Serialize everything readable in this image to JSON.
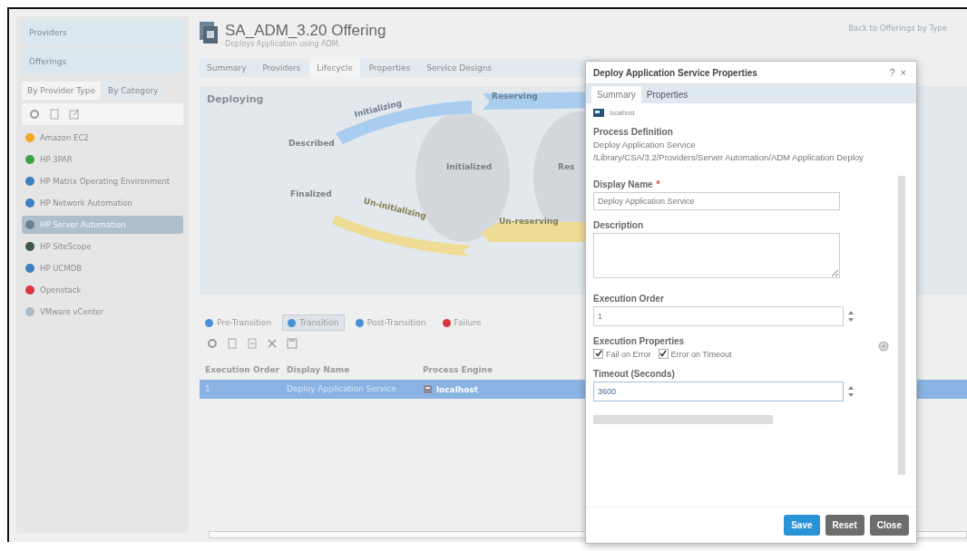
{
  "sidebar": {
    "sections": [
      {
        "label": "Providers"
      },
      {
        "label": "Offerings"
      }
    ],
    "tabs": [
      {
        "label": "By Provider Type",
        "selected": true
      },
      {
        "label": "By Category",
        "selected": false
      }
    ],
    "items": [
      {
        "label": "Amazon EC2",
        "color": "#f2a623",
        "selected": false
      },
      {
        "label": "HP 3PAR",
        "color": "#3aa34a",
        "selected": false
      },
      {
        "label": "HP Matrix Operating Environment",
        "color": "#3d7fc1",
        "selected": false
      },
      {
        "label": "HP Network Automation",
        "color": "#3d7fc1",
        "selected": false
      },
      {
        "label": "HP Server Automation",
        "color": "#6d7f92",
        "selected": true
      },
      {
        "label": "HP SiteScope",
        "color": "#3e5a44",
        "selected": false
      },
      {
        "label": "HP UCMDB",
        "color": "#3d7fc1",
        "selected": false
      },
      {
        "label": "Openstack",
        "color": "#d9363e",
        "selected": false
      },
      {
        "label": "VMware vCenter",
        "color": "#a9bccb",
        "selected": false
      }
    ]
  },
  "header": {
    "title": "SA_ADM_3.20 Offering",
    "subtitle": "Deploys Application using ADM.",
    "back_link": "Back to Offerings by Type"
  },
  "tabs": [
    {
      "label": "Summary",
      "selected": false
    },
    {
      "label": "Providers",
      "selected": false
    },
    {
      "label": "Lifecycle",
      "selected": true
    },
    {
      "label": "Properties",
      "selected": false
    },
    {
      "label": "Service Designs",
      "selected": false
    }
  ],
  "lifecycle": {
    "heading": "Deploying",
    "labels": [
      {
        "text": "Initializing",
        "kind": "forward"
      },
      {
        "text": "Reserving",
        "kind": "forward"
      },
      {
        "text": "Described",
        "kind": "state"
      },
      {
        "text": "Initialized",
        "kind": "state"
      },
      {
        "text": "Res",
        "kind": "state"
      },
      {
        "text": "Finalized",
        "kind": "state"
      },
      {
        "text": "Un-initializing",
        "kind": "backward"
      },
      {
        "text": "Un-reserving",
        "kind": "backward"
      }
    ]
  },
  "transition_tabs": [
    {
      "label": "Pre-Transition",
      "color": "#4a90d9",
      "selected": false
    },
    {
      "label": "Transition",
      "color": "#4a90d9",
      "selected": true
    },
    {
      "label": "Post-Transition",
      "color": "#4a90d9",
      "selected": false
    },
    {
      "label": "Failure",
      "color": "#d9363e",
      "selected": false
    }
  ],
  "table": {
    "columns": [
      "Execution Order",
      "Display Name",
      "Process Engine"
    ],
    "rows": [
      {
        "cells": [
          "1",
          "Deploy Application Service",
          "localhost"
        ],
        "selected": true
      }
    ]
  },
  "dialog": {
    "title": "Deploy Application Service Properties",
    "help": "?",
    "close": "×",
    "tabs": [
      {
        "label": "Summary",
        "selected": true
      },
      {
        "label": "Properties",
        "selected": false
      }
    ],
    "engine": "localhost",
    "process_heading": "Process Definition",
    "process_name": "Deploy Application Service",
    "process_path": "/Library/CSA/3.2/Providers/Server Automation/ADM Application Deploy",
    "display_name_label": "Display Name",
    "required_mark": "*",
    "display_name": "Deploy Application Service",
    "description_label": "Description",
    "order_label": "Execution Order",
    "order": "1",
    "exec_label": "Execution Properties",
    "checks": [
      {
        "label": "Fail on Error",
        "checked": true
      },
      {
        "label": "Error on Timeout",
        "checked": true
      }
    ],
    "timeout_label": "Timeout (Seconds)",
    "timeout": "3600",
    "buttons": [
      {
        "label": "Save",
        "kind": "primary"
      },
      {
        "label": "Reset",
        "kind": "secondary"
      },
      {
        "label": "Close",
        "kind": "secondary"
      }
    ]
  }
}
